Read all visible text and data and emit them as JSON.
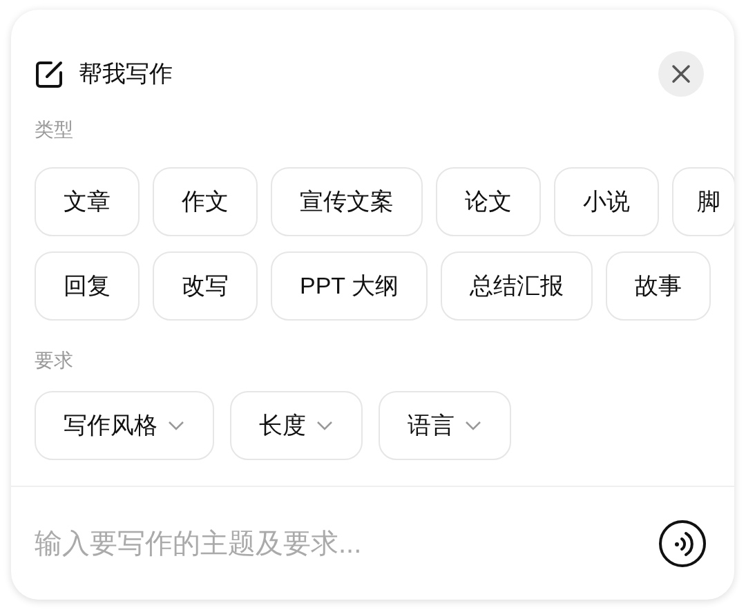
{
  "panel": {
    "title": "帮我写作"
  },
  "type_section": {
    "label": "类型",
    "rows": [
      [
        "文章",
        "作文",
        "宣传文案",
        "论文",
        "小说",
        "脚"
      ],
      [
        "回复",
        "改写",
        "PPT 大纲",
        "总结汇报",
        "故事"
      ]
    ]
  },
  "requirement_section": {
    "label": "要求",
    "dropdowns": [
      "写作风格",
      "长度",
      "语言"
    ]
  },
  "input": {
    "placeholder": "输入要写作的主题及要求..."
  }
}
